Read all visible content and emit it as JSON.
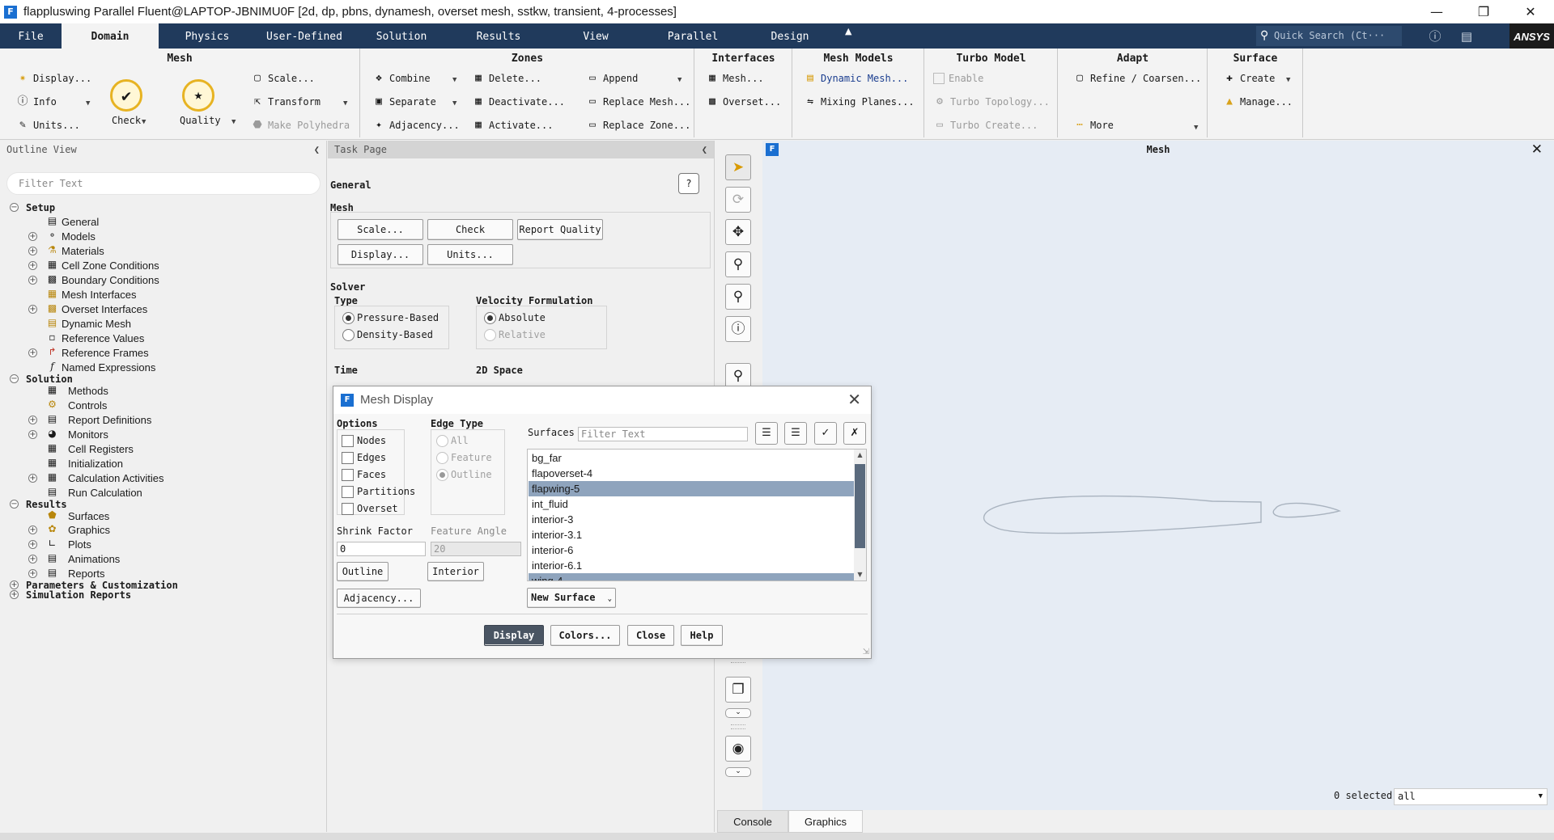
{
  "window": {
    "title": "flappluswing Parallel Fluent@LAPTOP-JBNIMU0F  [2d, dp, pbns, dynamesh, overset mesh, sstkw, transient, 4-processes]",
    "app_icon": "F"
  },
  "ribbon_tabs": [
    "File",
    "Domain",
    "Physics",
    "User-Defined",
    "Solution",
    "Results",
    "View",
    "Parallel",
    "Design"
  ],
  "active_tab": "Domain",
  "quick_search_placeholder": "Quick Search (Ct···",
  "brand": "ANSYS",
  "ribbon": {
    "mesh": {
      "title": "Mesh",
      "display": "Display...",
      "info": "Info",
      "units": "Units...",
      "check": "Check",
      "quality": "Quality",
      "scale": "Scale...",
      "transform": "Transform",
      "make_polyhedra": "Make Polyhedra"
    },
    "zones": {
      "title": "Zones",
      "combine": "Combine",
      "separate": "Separate",
      "adjacency": "Adjacency...",
      "delete": "Delete...",
      "deactivate": "Deactivate...",
      "activate": "Activate...",
      "append": "Append",
      "replace_mesh": "Replace Mesh...",
      "replace_zone": "Replace Zone..."
    },
    "interfaces": {
      "title": "Interfaces",
      "mesh": "Mesh...",
      "overset": "Overset..."
    },
    "mesh_models": {
      "title": "Mesh Models",
      "dynamic_mesh": "Dynamic Mesh...",
      "mixing_planes": "Mixing Planes..."
    },
    "turbo_model": {
      "title": "Turbo Model",
      "enable": "Enable",
      "turbo_topology": "Turbo Topology...",
      "turbo_create": "Turbo Create..."
    },
    "adapt": {
      "title": "Adapt",
      "refine": "Refine / Coarsen...",
      "more": "More"
    },
    "surface": {
      "title": "Surface",
      "create": "Create",
      "manage": "Manage..."
    }
  },
  "outline": {
    "title": "Outline View",
    "filter_placeholder": "Filter Text",
    "sections": {
      "setup": "Setup",
      "solution": "Solution",
      "results": "Results",
      "parameters": "Parameters & Customization",
      "simulation_reports": "Simulation Reports"
    },
    "setup_items": [
      "General",
      "Models",
      "Materials",
      "Cell Zone Conditions",
      "Boundary Conditions",
      "Mesh Interfaces",
      "Overset Interfaces",
      "Dynamic Mesh",
      "Reference Values",
      "Reference Frames",
      "Named Expressions"
    ],
    "solution_items": [
      "Methods",
      "Controls",
      "Report Definitions",
      "Monitors",
      "Cell Registers",
      "Initialization",
      "Calculation Activities",
      "Run Calculation"
    ],
    "results_items": [
      "Surfaces",
      "Graphics",
      "Plots",
      "Animations",
      "Reports"
    ]
  },
  "task_page": {
    "title": "Task Page",
    "general": "General",
    "mesh_label": "Mesh",
    "buttons": {
      "scale": "Scale...",
      "check": "Check",
      "report_quality": "Report Quality",
      "display": "Display...",
      "units": "Units..."
    },
    "solver": "Solver",
    "type_label": "Type",
    "type_options": [
      "Pressure-Based",
      "Density-Based"
    ],
    "type_selected": "Pressure-Based",
    "velocity_label": "Velocity Formulation",
    "velocity_options": [
      "Absolute",
      "Relative"
    ],
    "velocity_selected": "Absolute",
    "time_label": "Time",
    "space_label": "2D Space"
  },
  "graphics": {
    "title": "Mesh",
    "selected_count": "0 selected",
    "selection_filter": "all",
    "bottom_tabs": [
      "Console",
      "Graphics"
    ],
    "active_bottom_tab": "Graphics"
  },
  "mesh_display": {
    "title": "Mesh Display",
    "options_label": "Options",
    "options": [
      "Nodes",
      "Edges",
      "Faces",
      "Partitions",
      "Overset"
    ],
    "edge_type_label": "Edge Type",
    "edge_types": [
      "All",
      "Feature",
      "Outline"
    ],
    "edge_type_selected": "Outline",
    "shrink_factor_label": "Shrink Factor",
    "shrink_factor_value": "0",
    "feature_angle_label": "Feature Angle",
    "feature_angle_value": "20",
    "outline_btn": "Outline",
    "interior_btn": "Interior",
    "adjacency_btn": "Adjacency...",
    "surfaces_label": "Surfaces",
    "surfaces_filter_placeholder": "Filter Text",
    "surfaces": [
      "bg_far",
      "flapoverset-4",
      "flapwing-5",
      "int_fluid",
      "interior-3",
      "interior-3.1",
      "interior-6",
      "interior-6.1",
      "wing-4"
    ],
    "surfaces_selected": [
      "flapwing-5",
      "wing-4"
    ],
    "new_surface": "New Surface",
    "footer": {
      "display": "Display",
      "colors": "Colors...",
      "close": "Close",
      "help": "Help"
    }
  },
  "colors": {
    "ribbon_bar": "#203a5c",
    "graphics_bg": "#e6ecf4",
    "selection": "#8fa4bd",
    "display_btn": "#4a5563"
  }
}
